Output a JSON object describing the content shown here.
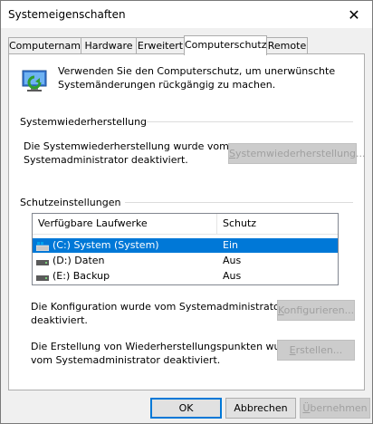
{
  "window": {
    "title": "Systemeigenschaften"
  },
  "tabs": [
    {
      "label": "Computername"
    },
    {
      "label": "Hardware"
    },
    {
      "label": "Erweitert"
    },
    {
      "label": "Computerschutz"
    },
    {
      "label": "Remote"
    }
  ],
  "intro": {
    "line1": "Verwenden Sie den Computerschutz, um unerwünschte",
    "line2": "Systemänderungen rückgängig zu machen."
  },
  "restore": {
    "heading": "Systemwiederherstellung",
    "text_line1": "Die Systemwiederherstellung wurde vom",
    "text_line2": "Systemadministrator deaktiviert.",
    "button_first": "S",
    "button_rest": "ystemwiederherstellung..."
  },
  "protection": {
    "heading": "Schutzeinstellungen",
    "columns": [
      "Verfügbare Laufwerke",
      "Schutz"
    ],
    "drives": [
      {
        "name": "(C:) System (System)",
        "status": "Ein"
      },
      {
        "name": "(D:) Daten",
        "status": "Aus"
      },
      {
        "name": "(E:) Backup",
        "status": "Aus"
      }
    ],
    "config_text_line1": "Die Konfiguration wurde vom Systemadministrator",
    "config_text_line2": "deaktiviert.",
    "config_button_first": "K",
    "config_button_rest": "onfigurieren...",
    "create_text_line1": "Die Erstellung von Wiederherstellungspunkten wurde",
    "create_text_line2": "vom Systemadministrator deaktiviert.",
    "create_button_first": "E",
    "create_button_rest": "rstellen..."
  },
  "footer": {
    "ok": "OK",
    "cancel": "Abbrechen",
    "apply_first": "Ü",
    "apply_rest": "bernehmen"
  },
  "colors": {
    "selection": "#0078d7",
    "window_bg": "#f0f0f0"
  }
}
